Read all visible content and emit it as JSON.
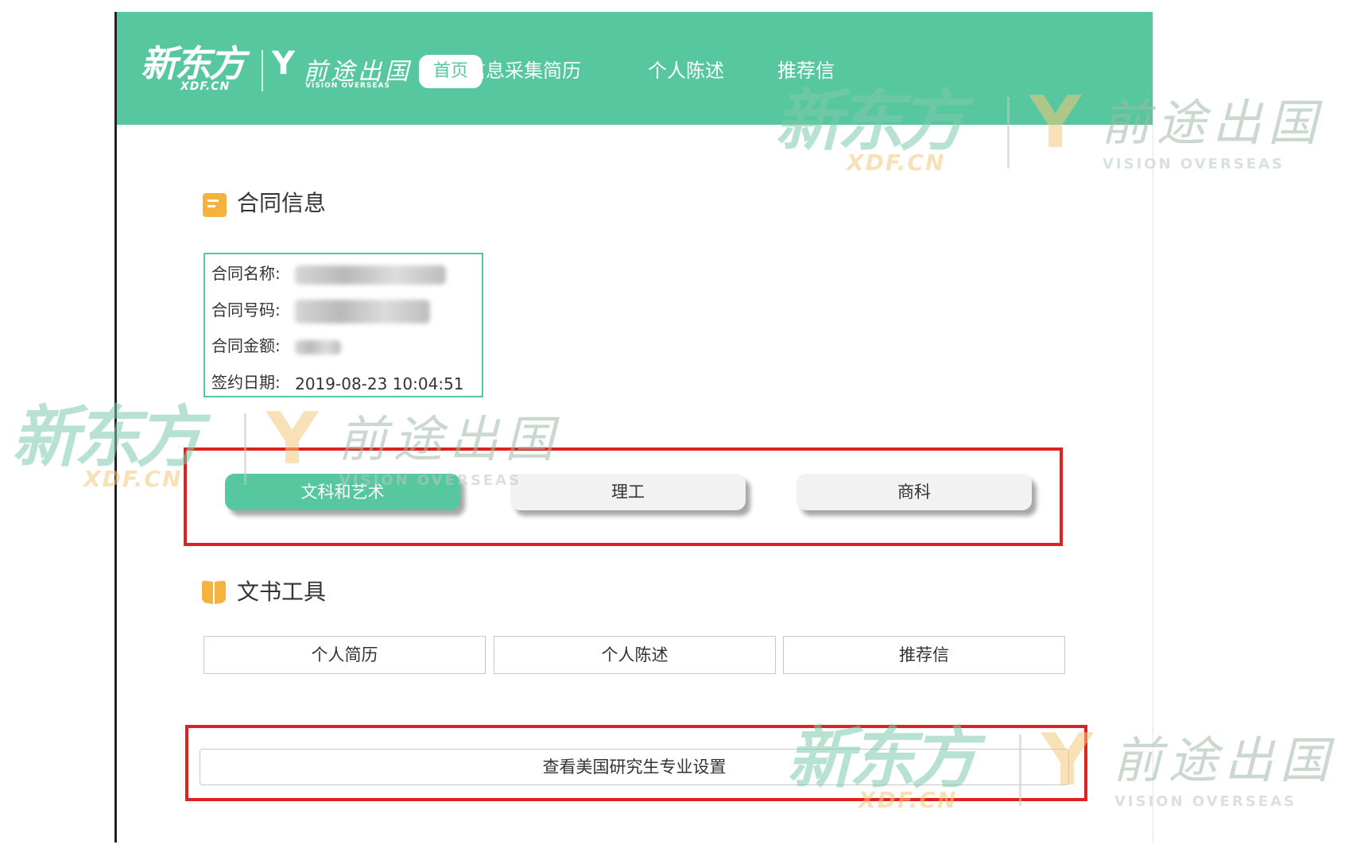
{
  "header": {
    "logo_xdf": {
      "cn": "新东方",
      "en": "XDF.CN"
    },
    "logo_vision": {
      "cn": "前途出国",
      "en": "VISION OVERSEAS"
    },
    "nav": [
      {
        "label": "首页"
      },
      {
        "label": "信息采集简历"
      },
      {
        "label": "个人陈述"
      },
      {
        "label": "推荐信"
      }
    ]
  },
  "contract_section": {
    "title": "合同信息",
    "rows": [
      {
        "label": "合同名称:",
        "value": ""
      },
      {
        "label": "合同号码:",
        "value": ""
      },
      {
        "label": "合同金额:",
        "value": ""
      },
      {
        "label": "签约日期:",
        "value": "2019-08-23 10:04:51"
      }
    ]
  },
  "categories": [
    {
      "label": "文科和艺术",
      "active": true
    },
    {
      "label": "理工",
      "active": false
    },
    {
      "label": "商科",
      "active": false
    }
  ],
  "tools_section": {
    "title": "文书工具",
    "buttons": [
      {
        "label": "个人简历"
      },
      {
        "label": "个人陈述"
      },
      {
        "label": "推荐信"
      }
    ]
  },
  "majors_button": {
    "label": "查看美国研究生专业设置"
  },
  "watermark": {
    "cn": "新东方",
    "en": "XDF.CN",
    "vision_cn": "前途出国",
    "vision_en": "VISION OVERSEAS"
  },
  "colors": {
    "brand_green": "#56c79e",
    "highlight_red": "#e02121",
    "icon_orange": "#f3b33e"
  }
}
